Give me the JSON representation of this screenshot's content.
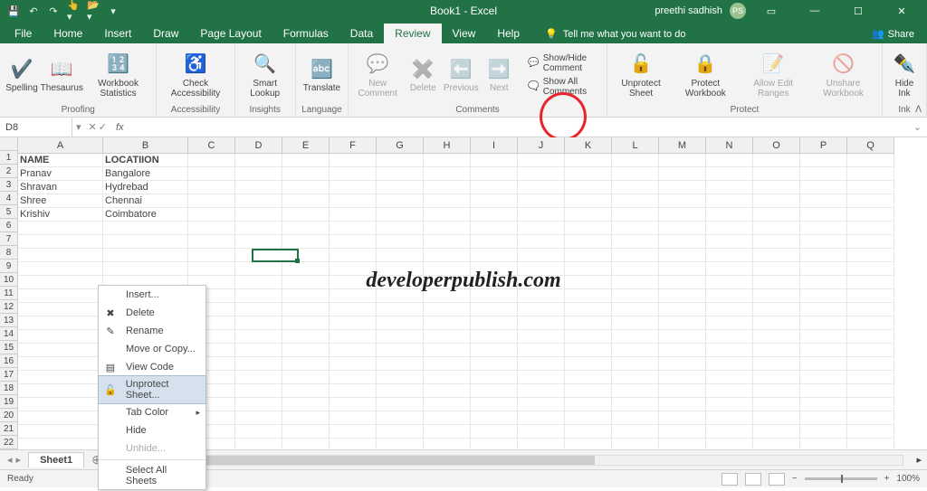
{
  "title": "Book1 - Excel",
  "user": {
    "name": "preethi sadhish",
    "initials": "PS"
  },
  "tabs": [
    "File",
    "Home",
    "Insert",
    "Draw",
    "Page Layout",
    "Formulas",
    "Data",
    "Review",
    "View",
    "Help"
  ],
  "activeTab": "Review",
  "tellme": "Tell me what you want to do",
  "share": "Share",
  "ribbon": {
    "proofing": {
      "label": "Proofing",
      "spelling": "Spelling",
      "thesaurus": "Thesaurus",
      "stats": "Workbook\nStatistics"
    },
    "accessibility": {
      "label": "Accessibility",
      "check": "Check\nAccessibility"
    },
    "insights": {
      "label": "Insights",
      "lookup": "Smart\nLookup"
    },
    "language": {
      "label": "Language",
      "translate": "Translate"
    },
    "comments": {
      "label": "Comments",
      "new": "New\nComment",
      "delete": "Delete",
      "prev": "Previous",
      "next": "Next",
      "showhide": "Show/Hide Comment",
      "showall": "Show All Comments"
    },
    "protect": {
      "label": "Protect",
      "unprotect": "Unprotect\nSheet",
      "workbook": "Protect\nWorkbook",
      "ranges": "Allow Edit\nRanges",
      "unshare": "Unshare\nWorkbook"
    },
    "ink": {
      "label": "Ink",
      "hide": "Hide\nInk"
    }
  },
  "namebox": "D8",
  "columns": [
    "A",
    "B",
    "C",
    "D",
    "E",
    "F",
    "G",
    "H",
    "I",
    "J",
    "K",
    "L",
    "M",
    "N",
    "O",
    "P",
    "Q"
  ],
  "rows": [
    1,
    2,
    3,
    4,
    5,
    6,
    7,
    8,
    9,
    10,
    11,
    12,
    13,
    14,
    15,
    16,
    17,
    18,
    19,
    20,
    21,
    22
  ],
  "data": {
    "headers": [
      "NAME",
      "LOCATIION"
    ],
    "rows": [
      [
        "Pranav",
        "Bangalore"
      ],
      [
        "Shravan",
        "Hydrebad"
      ],
      [
        "Shree",
        "Chennai"
      ],
      [
        "Krishiv",
        "Coimbatore"
      ]
    ]
  },
  "watermark": "developerpublish.com",
  "ctx": {
    "insert": "Insert...",
    "delete": "Delete",
    "rename": "Rename",
    "move": "Move or Copy...",
    "viewcode": "View Code",
    "unprotect": "Unprotect Sheet...",
    "tabcolor": "Tab Color",
    "hide": "Hide",
    "unhide": "Unhide...",
    "selectall": "Select All Sheets"
  },
  "sheet": "Sheet1",
  "status": "Ready",
  "zoom": "100%"
}
